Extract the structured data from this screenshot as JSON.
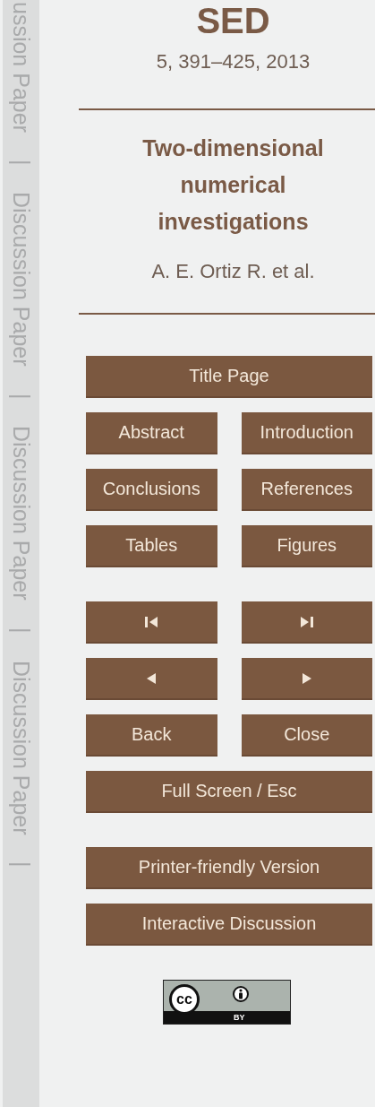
{
  "sidebar": {
    "items": [
      {
        "kind": "label",
        "text": "ussion Paper"
      },
      {
        "kind": "divider",
        "text": "|"
      },
      {
        "kind": "label",
        "text": "Discussion Paper"
      },
      {
        "kind": "divider",
        "text": "|"
      },
      {
        "kind": "label",
        "text": "Discussion Paper"
      },
      {
        "kind": "divider",
        "text": "|"
      },
      {
        "kind": "label",
        "text": "Discussion Paper"
      },
      {
        "kind": "divider",
        "text": "|"
      }
    ]
  },
  "journal": "SED",
  "volume": "5, 391–425, 2013",
  "title": "Two-dimensional numerical investigations",
  "authors": "A. E. Ortiz R. et al.",
  "nav_groups": [
    [
      [
        {
          "kind": "text",
          "label": "Title Page"
        }
      ],
      [
        {
          "kind": "text",
          "label": "Abstract"
        },
        {
          "kind": "text",
          "label": "Introduction"
        }
      ],
      [
        {
          "kind": "text",
          "label": "Conclusions"
        },
        {
          "kind": "text",
          "label": "References"
        }
      ],
      [
        {
          "kind": "text",
          "label": "Tables"
        },
        {
          "kind": "text",
          "label": "Figures"
        }
      ]
    ],
    [
      [
        {
          "kind": "first"
        },
        {
          "kind": "last"
        }
      ],
      [
        {
          "kind": "previous"
        },
        {
          "kind": "next"
        }
      ],
      [
        {
          "kind": "text",
          "label": "Back"
        },
        {
          "kind": "text",
          "label": "Close"
        }
      ],
      [
        {
          "kind": "text",
          "label": "Full Screen / Esc"
        }
      ]
    ],
    [
      [
        {
          "kind": "text",
          "label": "Printer-friendly Version"
        }
      ],
      [
        {
          "kind": "text",
          "label": "Interactive Discussion"
        }
      ]
    ]
  ],
  "license": {
    "mark": "cc",
    "label": "BY"
  }
}
